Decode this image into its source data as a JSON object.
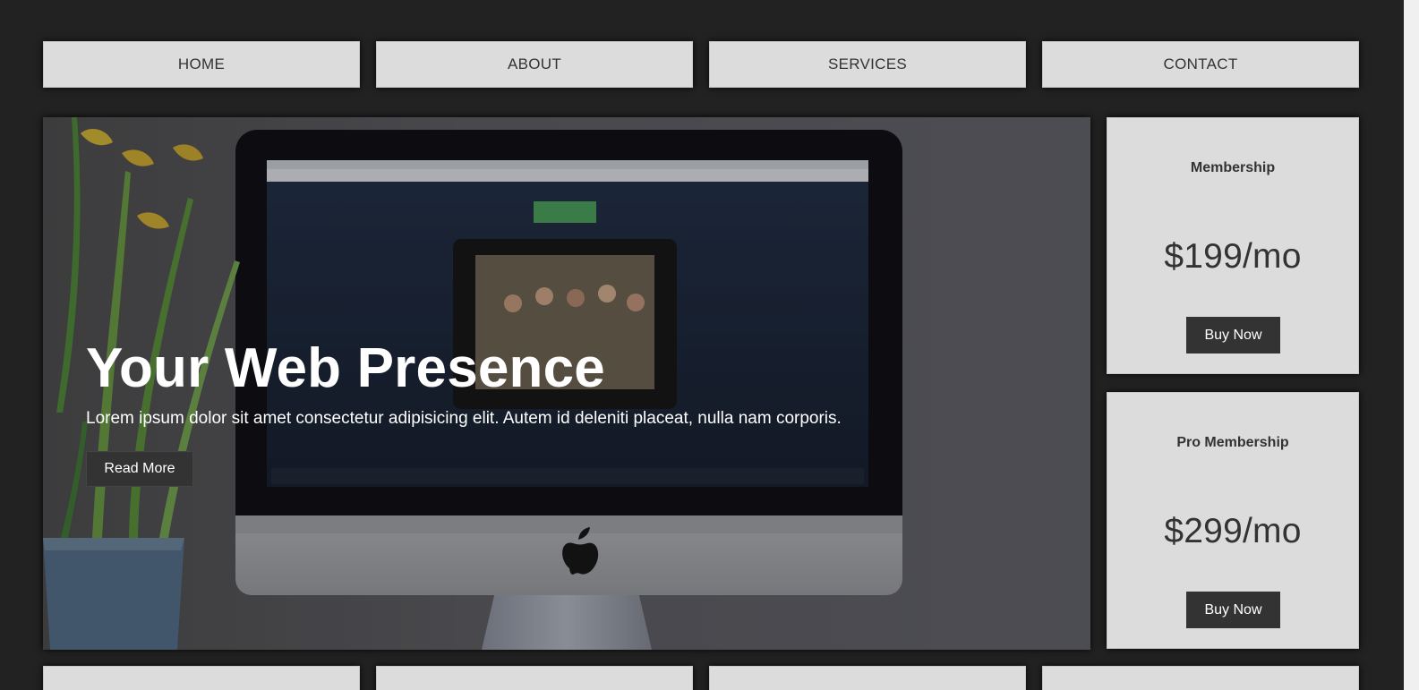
{
  "nav": {
    "items": [
      {
        "label": "HOME"
      },
      {
        "label": "ABOUT"
      },
      {
        "label": "SERVICES"
      },
      {
        "label": "CONTACT"
      }
    ]
  },
  "hero": {
    "title": "Your Web Presence",
    "text": "Lorem ipsum dolor sit amet consectetur adipisicing elit. Autem id deleniti placeat, nulla nam corporis.",
    "button_label": "Read More",
    "image_icons": [
      "computer-monitor-icon",
      "plant-icon",
      "apple-logo-icon"
    ]
  },
  "pricing": [
    {
      "title": "Membership",
      "price": "$199/mo",
      "button_label": "Buy Now"
    },
    {
      "title": "Pro Membership",
      "price": "$299/mo",
      "button_label": "Buy Now"
    }
  ],
  "colors": {
    "page_bg": "#222222",
    "box_bg": "#dcdcdc",
    "button_bg": "#333333",
    "text": "#333333"
  }
}
